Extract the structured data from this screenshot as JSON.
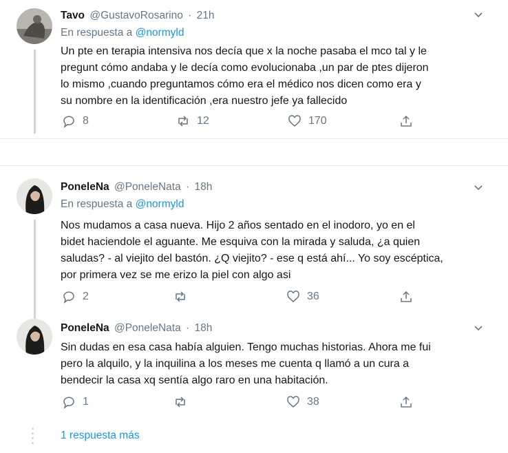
{
  "tweets": [
    {
      "name": "Tavo",
      "handle": "@GustavoRosarino",
      "time": "21h",
      "reply_prefix": "En respuesta a",
      "reply_to": "@normyld",
      "text_lines": [
        "Un pte en terapia intensiva nos decía que x la noche pasaba el mco tal y le",
        "pregunt cómo andaba y le decía como evolucionaba ,un par de ptes dijeron",
        "lo mismo ,cuando preguntamos cómo era el médico nos dicen  como era y",
        "su nombre en la identificación ,era nuestro jefe ya fallecido"
      ],
      "replies": "8",
      "retweets": "12",
      "likes": "170"
    },
    {
      "name": "PoneleNa",
      "handle": "@PoneleNata",
      "time": "18h",
      "reply_prefix": "En respuesta a",
      "reply_to": "@normyld",
      "text_lines": [
        "Nos mudamos a casa nueva. Hijo 2 años sentado en el inodoro, yo en el",
        "bidet haciendole el aguante. Me esquiva   con la mirada y saluda, ¿a quien",
        "saludas? - al viejito del bastón. ¿Q viejito? - ese q está ahí... Yo soy escéptica,",
        "por primera vez se me erizo la piel con algo asi"
      ],
      "replies": "2",
      "retweets": "",
      "likes": "36"
    },
    {
      "name": "PoneleNa",
      "handle": "@PoneleNata",
      "time": "18h",
      "text_lines": [
        "Sin dudas en esa casa había alguien. Tengo muchas historias. Ahora me fui",
        "pero la alquilo, y la inquilina a  los meses me cuenta q llamó a un cura a",
        "bendecir la casa xq sentía algo raro en una habitación."
      ],
      "replies": "1",
      "retweets": "",
      "likes": "38"
    }
  ],
  "more_replies": "1 respuesta más",
  "icons": [
    "reply-icon",
    "retweet-icon",
    "like-icon",
    "share-icon",
    "chevron-down-icon"
  ],
  "colors": {
    "link": "#1b95e0",
    "muted": "#657786",
    "text": "#14171a",
    "line": "#ccd6dd"
  }
}
